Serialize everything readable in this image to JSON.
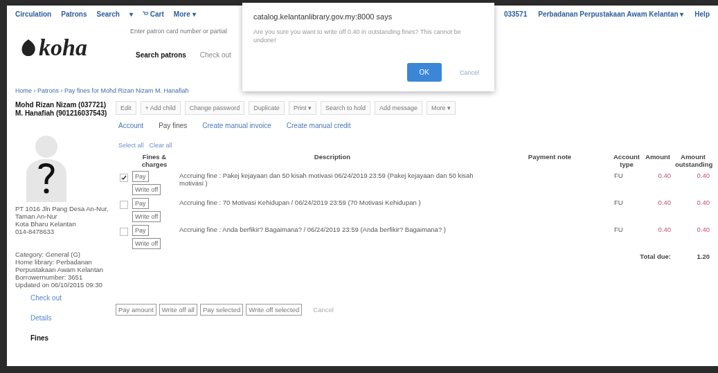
{
  "top_nav": {
    "items": [
      {
        "label": "Circulation",
        "kind": "link"
      },
      {
        "label": "Patrons",
        "kind": "link"
      },
      {
        "label": "Search",
        "kind": "link"
      },
      {
        "label": "▾",
        "kind": "link"
      },
      {
        "label": "Cart",
        "kind": "cart"
      },
      {
        "label": "More ▾",
        "kind": "link"
      }
    ],
    "user": "033571",
    "branch": "Perbadanan Perpustakaan Awam Kelantan ▾",
    "help": "Help"
  },
  "logo": "koha",
  "patron_search": {
    "placeholder": "Enter patron card number or partial",
    "tabs": [
      {
        "label": "Search patrons",
        "selected": true
      },
      {
        "label": "Check out",
        "selected": false
      }
    ]
  },
  "breadcrumb": "Home › Patrons › Pay fines for Mohd Rizan Nizam M. Hanafiah",
  "patron": {
    "name": "Mohd Rizan Nizam (037721) M. Hanafiah (901216037543)",
    "address": [
      "PT 1016 Jln Pang Desa An-Nur, Taman An-Nur",
      "Kota Bharu Kelantan",
      "014-8478633"
    ],
    "details": [
      "Category: General (G)",
      "Home library: Perbadanan Perpustakaan Awam Kelantan",
      "Borrowernumber: 3651",
      "Updated on 06/10/2015 09:30"
    ]
  },
  "side_nav": [
    {
      "label": "Check out",
      "selected": false
    },
    {
      "label": "Details",
      "selected": false
    },
    {
      "label": "Fines",
      "selected": true
    }
  ],
  "toolbar": [
    "Edit",
    "+ Add child",
    "Change password",
    "Duplicate",
    "Print ▾",
    "Search to hold",
    "Add message",
    "More ▾"
  ],
  "tabs": [
    {
      "label": "Account",
      "selected": false
    },
    {
      "label": "Pay fines",
      "selected": true
    },
    {
      "label": "Create manual invoice",
      "selected": false
    },
    {
      "label": "Create manual credit",
      "selected": false
    }
  ],
  "select_links": [
    "Select all",
    "Clear all"
  ],
  "table": {
    "columns": [
      "Fines & charges",
      "Description",
      "Payment note",
      "Account type",
      "Amount",
      "Amount outstanding"
    ],
    "rows": [
      {
        "checked": true,
        "pay": "Pay",
        "write_off": "Write off",
        "description": "Accruing fine : Pakej kejayaan dan 50 kisah motivasi 06/24/2019 23:59 (Pakej kejayaan dan 50 kisah motivasi )",
        "account_type": "FU",
        "amount": "0.40",
        "outstanding": "0.40"
      },
      {
        "checked": false,
        "pay": "Pay",
        "write_off": "Write off",
        "description": "Accruing fine : 70 Motivasi Kehidupan / 06/24/2019 23:59 (70 Motivasi Kehidupan )",
        "account_type": "FU",
        "amount": "0.40",
        "outstanding": "0.40"
      },
      {
        "checked": false,
        "pay": "Pay",
        "write_off": "Write off",
        "description": "Accruing fine : Anda berfikir? Bagaimana? / 06/24/2019 23:59 (Anda berfikir? Bagaimana? )",
        "account_type": "FU",
        "amount": "0.40",
        "outstanding": "0.40"
      }
    ],
    "total_label": "Total due:",
    "total": "1.20"
  },
  "actions": [
    "Pay amount",
    "Write off all",
    "Pay selected",
    "Write off selected"
  ],
  "cancel": "Cancel",
  "dialog": {
    "title": "catalog.kelantanlibrary.gov.my:8000 says",
    "message": "Are you sure you want to write off 0.40 in outstanding fines? This cannot be undone!",
    "ok": "OK",
    "cancel": "Cancel"
  }
}
